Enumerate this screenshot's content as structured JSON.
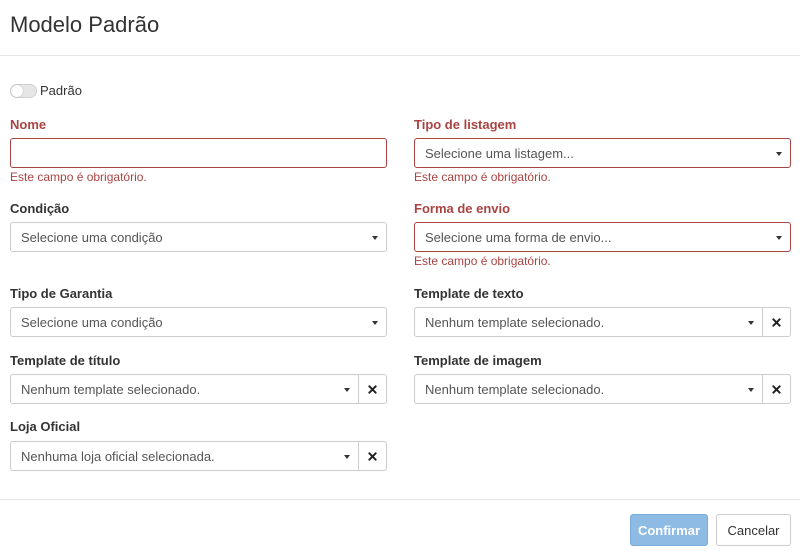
{
  "modal": {
    "title": "Modelo Padrão",
    "toggle_label": "Padrão",
    "required_msg": "Este campo é obrigatório."
  },
  "fields": {
    "nome": {
      "label": "Nome",
      "value": ""
    },
    "tipo_listagem": {
      "label": "Tipo de listagem",
      "placeholder": "Selecione uma listagem..."
    },
    "condicao": {
      "label": "Condição",
      "placeholder": "Selecione uma condição"
    },
    "forma_envio": {
      "label": "Forma de envio",
      "placeholder": "Selecione uma forma de envio..."
    },
    "tipo_garantia": {
      "label": "Tipo de Garantia",
      "placeholder": "Selecione uma condição"
    },
    "template_texto": {
      "label": "Template de texto",
      "placeholder": "Nenhum template selecionado."
    },
    "template_titulo": {
      "label": "Template de título",
      "placeholder": "Nenhum template selecionado."
    },
    "template_imagem": {
      "label": "Template de imagem",
      "placeholder": "Nenhum template selecionado."
    },
    "loja_oficial": {
      "label": "Loja Oficial",
      "placeholder": "Nenhuma loja oficial selecionada."
    }
  },
  "footer": {
    "confirm_label": "Confirmar",
    "cancel_label": "Cancelar"
  },
  "colors": {
    "error": "#a94442",
    "primary_disabled": "#8ebbe3"
  }
}
